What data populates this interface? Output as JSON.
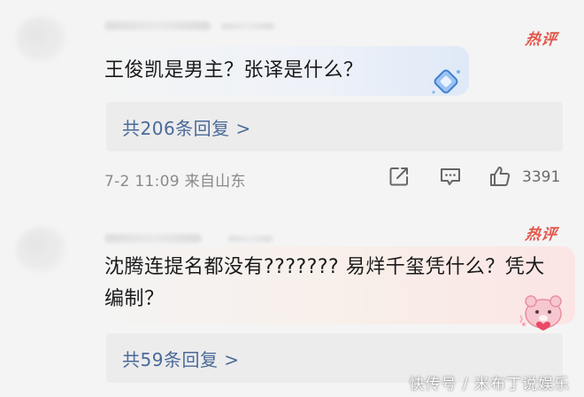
{
  "comments": [
    {
      "hot_badge": "热评",
      "text": "王俊凯是男主？张译是什么？",
      "reply_label": "共206条回复 >",
      "meta": "7-2 11:09  来自山东",
      "like_count": "3391"
    },
    {
      "hot_badge": "热评",
      "text": "沈腾连提名都没有???????  易烊千玺凭什么？凭大编制？",
      "reply_label": "共59条回复 >"
    }
  ],
  "watermark": "快传号 / 米布丁说娱乐",
  "icons": [
    "share-icon",
    "comment-icon",
    "like-icon",
    "diamond-sticker-icon",
    "bear-sticker-icon"
  ],
  "colors": {
    "hot_badge": "#e2574b",
    "reply_link": "#4a6a9a",
    "meta_text": "#8a8a8a"
  }
}
